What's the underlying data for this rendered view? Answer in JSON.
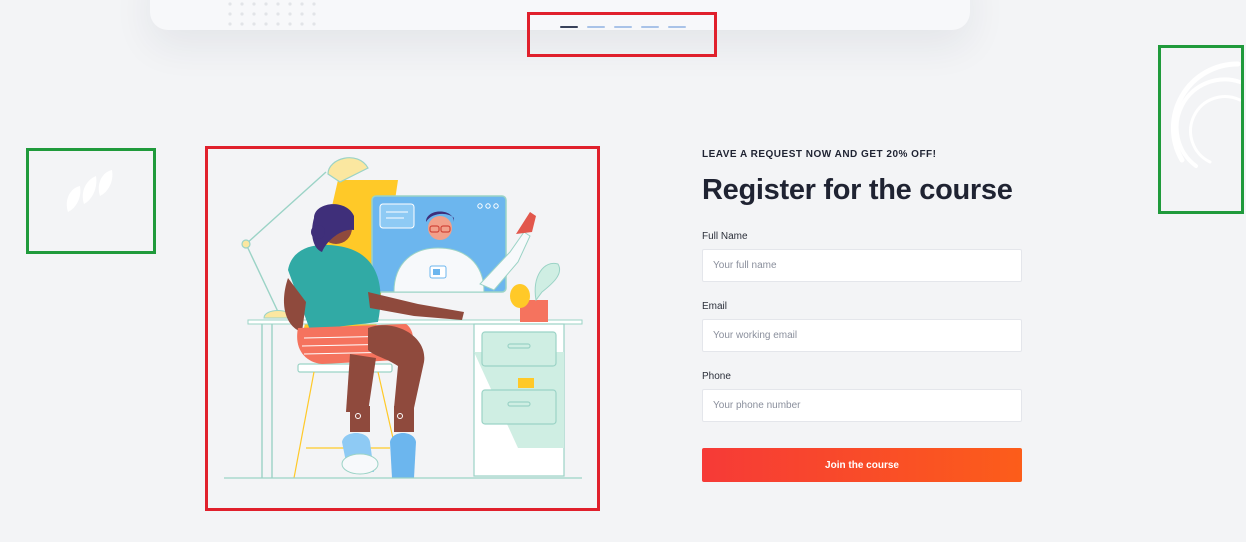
{
  "carousel": {
    "slide_count": 5,
    "active_index": 0
  },
  "register": {
    "eyebrow": "LEAVE A REQUEST NOW AND GET 20% OFF!",
    "title": "Register for the course",
    "fields": [
      {
        "label": "Full Name",
        "placeholder": "Your full name"
      },
      {
        "label": "Email",
        "placeholder": "Your working email"
      },
      {
        "label": "Phone",
        "placeholder": "Your phone number"
      }
    ],
    "submit_label": "Join the course"
  },
  "colors": {
    "background": "#f3f4f6",
    "accent_start": "#f63a37",
    "accent_end": "#fc5d1a",
    "heading": "#1f2332",
    "annotation_red": "#e0202c",
    "annotation_green": "#1f9a3b"
  },
  "icons": [
    "dot-grid-pattern",
    "carousel-dots",
    "feather-shapes",
    "concentric-arcs",
    "video-call-illustration"
  ]
}
